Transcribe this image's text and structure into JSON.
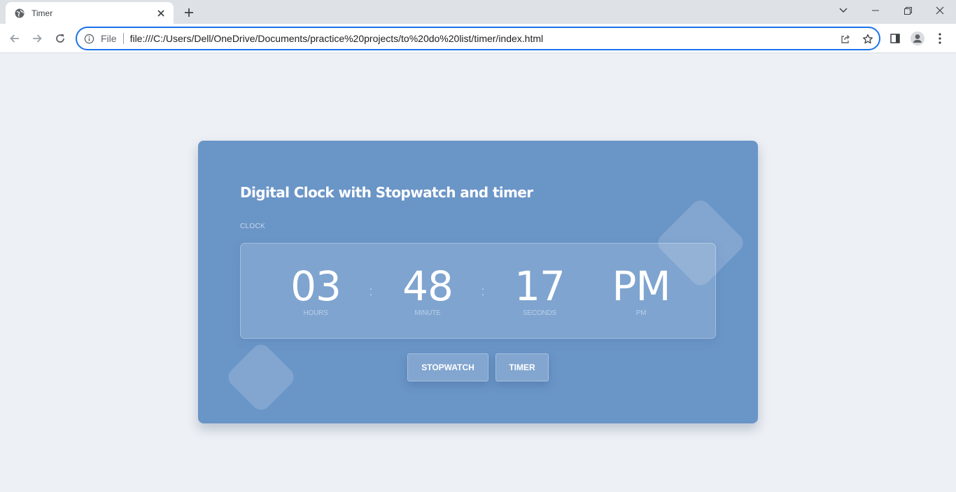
{
  "browser": {
    "tab_title": "Timer",
    "omnibox_scheme_label": "File",
    "url": "file:///C:/Users/Dell/OneDrive/Documents/practice%20projects/to%20do%20list/timer/index.html",
    "accent_color": "#1a73e8"
  },
  "page": {
    "title": "Digital Clock with Stopwatch and timer",
    "section_label": "CLOCK",
    "clock": {
      "hours": "03",
      "hours_label": "HOURS",
      "minutes": "48",
      "minutes_label": "MINUTE",
      "seconds": "17",
      "seconds_label": "SECONDS",
      "period": "PM",
      "period_label": "PM",
      "separator": ":"
    },
    "buttons": {
      "stopwatch": "STOPWATCH",
      "timer": "TIMER"
    },
    "colors": {
      "page_background": "#edf0f5",
      "card_background": "#6a95c7"
    }
  }
}
